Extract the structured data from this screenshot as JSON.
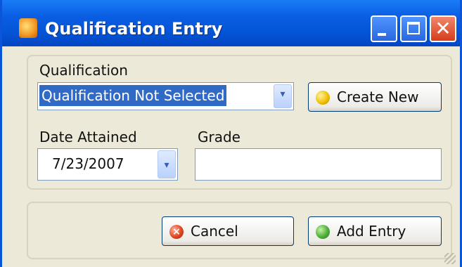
{
  "window": {
    "title": "Qualification Entry",
    "close_glyph": "✕"
  },
  "form": {
    "qualification_label": "Qualification",
    "qualification_value": "Qualification Not Selected",
    "create_new_label": "Create New",
    "date_label": "Date Attained",
    "date_value": "7/23/2007",
    "grade_label": "Grade",
    "grade_value": ""
  },
  "actions": {
    "cancel_label": "Cancel",
    "add_entry_label": "Add Entry"
  },
  "icons": {
    "dropdown_glyph": "▾",
    "cancel_glyph": "×"
  }
}
